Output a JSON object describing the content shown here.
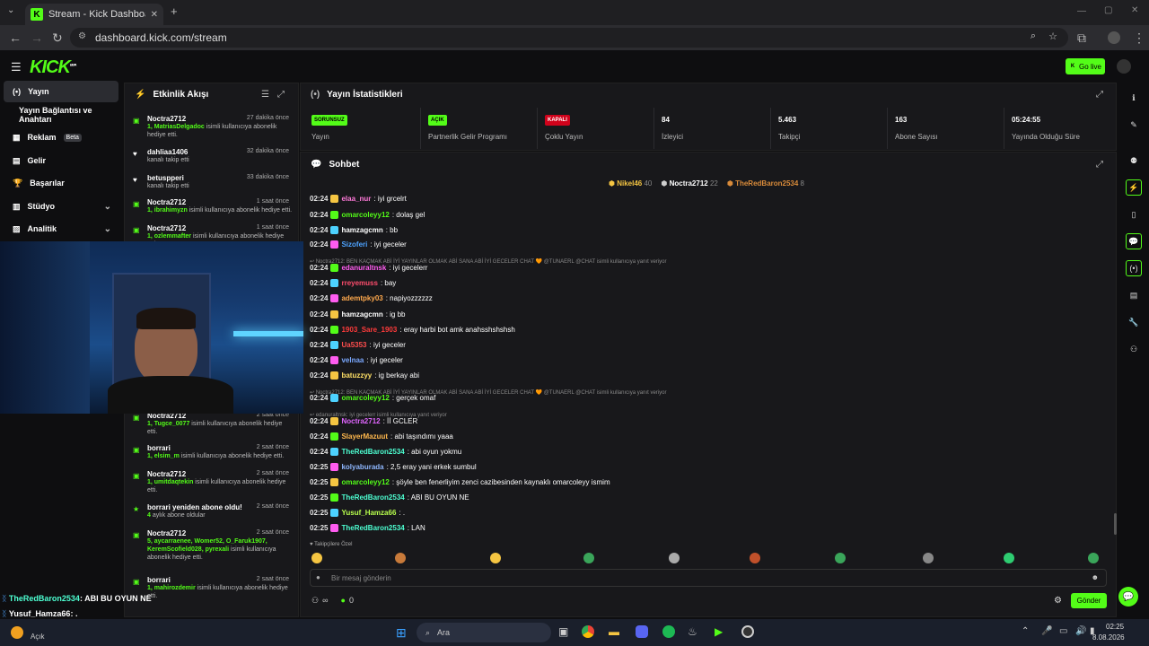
{
  "browser": {
    "tab_title": "Stream - Kick Dashboard",
    "url": "dashboard.kick.com/stream"
  },
  "app": {
    "logo": "KICK",
    "logo_tag": "BETA",
    "go_live": "Go live"
  },
  "sidebar": {
    "items": [
      {
        "label": "Yayın",
        "icon": "broadcast-icon",
        "active": true
      },
      {
        "label": "Yayın Bağlantısı ve Anahtarı",
        "icon": "",
        "active": false
      },
      {
        "label": "Reklam",
        "icon": "ad-icon",
        "badge": "Beta"
      },
      {
        "label": "Gelir",
        "icon": "chart-icon"
      },
      {
        "label": "Başarılar",
        "icon": "trophy-icon"
      },
      {
        "label": "Stüdyo",
        "icon": "studio-icon",
        "chevron": true
      },
      {
        "label": "Analitik",
        "icon": "analytics-icon",
        "chevron": true
      }
    ]
  },
  "activity": {
    "title": "Etkinlik Akışı",
    "items": [
      {
        "icon": "gift-icon",
        "name": "Noctra2712",
        "time": "27 dakika önce",
        "desc_b": "1, MatriasDelgadoc",
        "desc": " isimli kullanıcıya abonelik hediye etti."
      },
      {
        "icon": "heart-icon",
        "name": "dahliaa1406",
        "time": "32 dakika önce",
        "desc_b": "",
        "desc": "kanalı takip etti"
      },
      {
        "icon": "heart-icon",
        "name": "betuspperi",
        "time": "33 dakika önce",
        "desc_b": "",
        "desc": "kanalı takip etti"
      },
      {
        "icon": "gift-icon",
        "name": "Noctra2712",
        "time": "1 saat önce",
        "desc_b": "1, ibrahimyzn",
        "desc": " isimli kullanıcıya abonelik hediye etti."
      },
      {
        "icon": "gift-icon",
        "name": "Noctra2712",
        "time": "1 saat önce",
        "desc_b": "1, ozlemmafter",
        "desc": " isimli kullanıcıya abonelik hediye etti."
      },
      {
        "icon": "gift-icon",
        "name": "Noctra2712",
        "time": "2 saat önce",
        "desc_b": "1, Tugce_0077",
        "desc": " isimli kullanıcıya abonelik hediye etti."
      },
      {
        "icon": "gift-icon",
        "name": "borrari",
        "time": "2 saat önce",
        "desc_b": "1, elsim_m",
        "desc": " isimli kullanıcıya abonelik hediye etti."
      },
      {
        "icon": "gift-icon",
        "name": "Noctra2712",
        "time": "2 saat önce",
        "desc_b": "1, umitdaqtekin",
        "desc": " isimli kullanıcıya abonelik hediye etti."
      },
      {
        "icon": "star-icon",
        "name": "borrari yeniden abone oldu!",
        "time": "2 saat önce",
        "desc_b": "4",
        "desc": " aylık abone oldular"
      },
      {
        "icon": "gift-icon",
        "name": "Noctra2712",
        "time": "2 saat önce",
        "desc_b": "5, aycarraenee, Womer52, O_Faruk1907, KeremScofield028, pyrexali",
        "desc": " isimli kullanıcıya abonelik hediye etti."
      },
      {
        "icon": "gift-icon",
        "name": "borrari",
        "time": "2 saat önce",
        "desc_b": "1, mahirozdemir",
        "desc": " isimli kullanıcıya abonelik hediye etti."
      }
    ]
  },
  "stats": {
    "title": "Yayın İstatistikleri",
    "cells": [
      {
        "pill": "SORUNSUZ",
        "pill_color": "#53fc18",
        "label": "Yayın"
      },
      {
        "pill": "AÇIK",
        "pill_color": "#53fc18",
        "label": "Partnerlik Gelir Programı"
      },
      {
        "pill": "KAPALI",
        "pill_color": "#d0021b",
        "label": "Çoklu Yayın"
      },
      {
        "value": "84",
        "label": "İzleyici"
      },
      {
        "value": "5.463",
        "label": "Takipçi"
      },
      {
        "value": "163",
        "label": "Abone Sayısı"
      },
      {
        "value": "05:24:55",
        "label": "Yayında Olduğu Süre"
      }
    ]
  },
  "chat": {
    "title": "Sohbet",
    "top_gifters": [
      {
        "name": "Nikel46",
        "count": "40",
        "color": "#f5c542"
      },
      {
        "name": "Noctra2712",
        "count": "22",
        "color": "#cfcfcf"
      },
      {
        "name": "TheRedBaron2534",
        "count": "8",
        "color": "#d98b3a"
      }
    ],
    "messages": [
      {
        "time": "02:24",
        "user": "elaa_nur",
        "color": "#ff7ad9",
        "text": "iyi grcelrt"
      },
      {
        "time": "02:24",
        "user": "omarcoleyy12",
        "color": "#53fc18",
        "text": "dolaş gel"
      },
      {
        "time": "02:24",
        "user": "hamzagcmn",
        "color": "#ffffff",
        "text": "bb"
      },
      {
        "time": "02:24",
        "user": "Sizoferi",
        "color": "#4da3ff",
        "text": "iyi geceler"
      },
      {
        "reply": "Noctra2712: BEN KAÇMAK ABİ İYİ YAYINLAR OLMAK ABİ SANA ABİ İYİ GECELER CHAT 🧡 @TUNAERL @CHAT isimli kullanıcıya yanıt veriyor"
      },
      {
        "time": "02:24",
        "user": "edanuraltnsk",
        "color": "#ff5cf0",
        "text": "iyi gecelerr"
      },
      {
        "time": "02:24",
        "user": "rreyemuss",
        "color": "#ff4d6d",
        "text": "bay"
      },
      {
        "time": "02:24",
        "user": "ademtpky03",
        "color": "#ffa94d",
        "text": "napiyozzzzzz"
      },
      {
        "time": "02:24",
        "user": "hamzagcmn",
        "color": "#ffffff",
        "text": "ig bb"
      },
      {
        "time": "02:24",
        "user": "1903_Sare_1903",
        "color": "#ff3b3b",
        "text": "eray harbi bot amk anahsshshshsh"
      },
      {
        "time": "02:24",
        "user": "Ua5353",
        "color": "#ff4d4d",
        "text": "iyi geceler"
      },
      {
        "time": "02:24",
        "user": "velnaa",
        "color": "#7aa8ff",
        "text": "iyi geceler"
      },
      {
        "time": "02:24",
        "user": "batuzzyy",
        "color": "#ffe066",
        "text": "ig berkay abi"
      },
      {
        "reply": "Noctra2712: BEN KAÇMAK ABİ İYİ YAYINLAR OLMAK ABİ SANA ABİ İYİ GECELER CHAT 🧡 @TUNAERL @CHAT isimli kullanıcıya yanıt veriyor"
      },
      {
        "time": "02:24",
        "user": "omarcoleyy12",
        "color": "#53fc18",
        "text": "gerçek omaf"
      },
      {
        "reply": "edanuraltnsk: iyi gecelerr isimli kullanıcıya yanıt veriyor"
      },
      {
        "time": "02:24",
        "user": "Noctra2712",
        "color": "#e066ff",
        "text": "İİ GCLER"
      },
      {
        "time": "02:24",
        "user": "SlayerMazuut",
        "color": "#ffb84d",
        "text": "abi taşındımı yaaa"
      },
      {
        "time": "02:24",
        "user": "TheRedBaron2534",
        "color": "#4dffd2",
        "text": "abi oyun yokmu"
      },
      {
        "time": "02:25",
        "user": "kolyaburada",
        "color": "#8fb8ff",
        "text": "2,5 eray yani erkek sumbul"
      },
      {
        "time": "02:25",
        "user": "omarcoleyy12",
        "color": "#53fc18",
        "text": "şöyle ben fenerliyim zenci cazibesinden kaynaklı omarcoleyy ismim"
      },
      {
        "time": "02:25",
        "user": "TheRedBaron2534",
        "color": "#4dffd2",
        "text": "ABI BU OYUN NE"
      },
      {
        "time": "02:25",
        "user": "Yusuf_Hamza66",
        "color": "#b8ff4d",
        "text": "."
      },
      {
        "time": "02:25",
        "user": "TheRedBaron2534",
        "color": "#4dffd2",
        "text": "LAN"
      }
    ],
    "followers_only": "Takipçilere Özel",
    "input_placeholder": "Bir mesaj gönderin",
    "send": "Gönder",
    "viewers_count": "0",
    "infinity": "∞"
  },
  "overlay": [
    {
      "user": "TheRedBaron2534",
      "text": ": ABI BU OYUN NE"
    },
    {
      "user": "Yusuf_Hamza66",
      "text": ": ."
    },
    {
      "user": "TheRedBaron2534",
      "text": ": LAN"
    }
  ],
  "taskbar": {
    "weather": "Açık",
    "search": "Ara",
    "time": "02:25",
    "date": "8.08.2026"
  }
}
